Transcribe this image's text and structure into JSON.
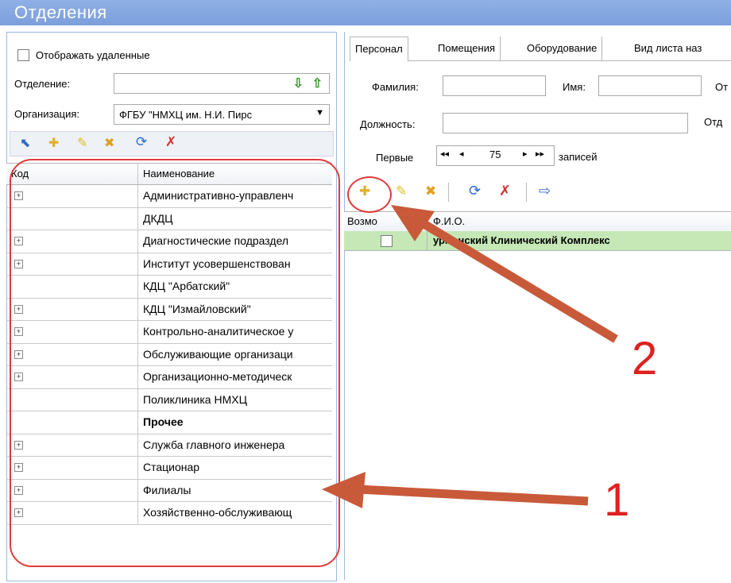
{
  "window": {
    "title": "Отделения"
  },
  "left": {
    "show_deleted_label": "Отображать удаленные",
    "department_label": "Отделение:",
    "department_value": "",
    "organization_label": "Организация:",
    "organization_value": "ФГБУ \"НМХЦ им. Н.И. Пирс",
    "columns": {
      "code": "Код",
      "name": "Наименование"
    },
    "rows": [
      {
        "name": "Административно-управленч",
        "expand": true
      },
      {
        "name": "ДКДЦ",
        "expand": false
      },
      {
        "name": "Диагностические подраздел",
        "expand": true
      },
      {
        "name": "Институт усовершенствован",
        "expand": true
      },
      {
        "name": "КДЦ \"Арбатский\"",
        "expand": false
      },
      {
        "name": "КДЦ \"Измайловский\"",
        "expand": true
      },
      {
        "name": "Контрольно-аналитическое у",
        "expand": true
      },
      {
        "name": "Обслуживающие организаци",
        "expand": true
      },
      {
        "name": "Организационно-методическ",
        "expand": true
      },
      {
        "name": "Поликлиника НМХЦ",
        "expand": false
      },
      {
        "name": "Прочее",
        "expand": false,
        "bold": true
      },
      {
        "name": "Служба главного инженера",
        "expand": true
      },
      {
        "name": "Стационар",
        "expand": true
      },
      {
        "name": "Филиалы",
        "expand": true
      },
      {
        "name": "Хозяйственно-обслуживающ",
        "expand": true
      }
    ]
  },
  "right": {
    "tabs": [
      "Персонал",
      "Помещения",
      "Оборудование",
      "Вид листа наз"
    ],
    "surname_label": "Фамилия:",
    "name_label": "Имя:",
    "partial_label_1": "От",
    "position_label": "Должность:",
    "partial_label_2": "Отд",
    "first_label": "Первые",
    "pager_value": "75",
    "records_label": "записей",
    "pager_first": "◂◂",
    "pager_prev": "◂",
    "pager_next": "▸",
    "pager_last": "▸▸",
    "grid_columns": {
      "col1": "Возмо",
      "col2": "Ф.И.О."
    },
    "grid_row_value": "урманский Клинический Комплекс"
  },
  "annotations": {
    "label_1": "1",
    "label_2": "2"
  }
}
